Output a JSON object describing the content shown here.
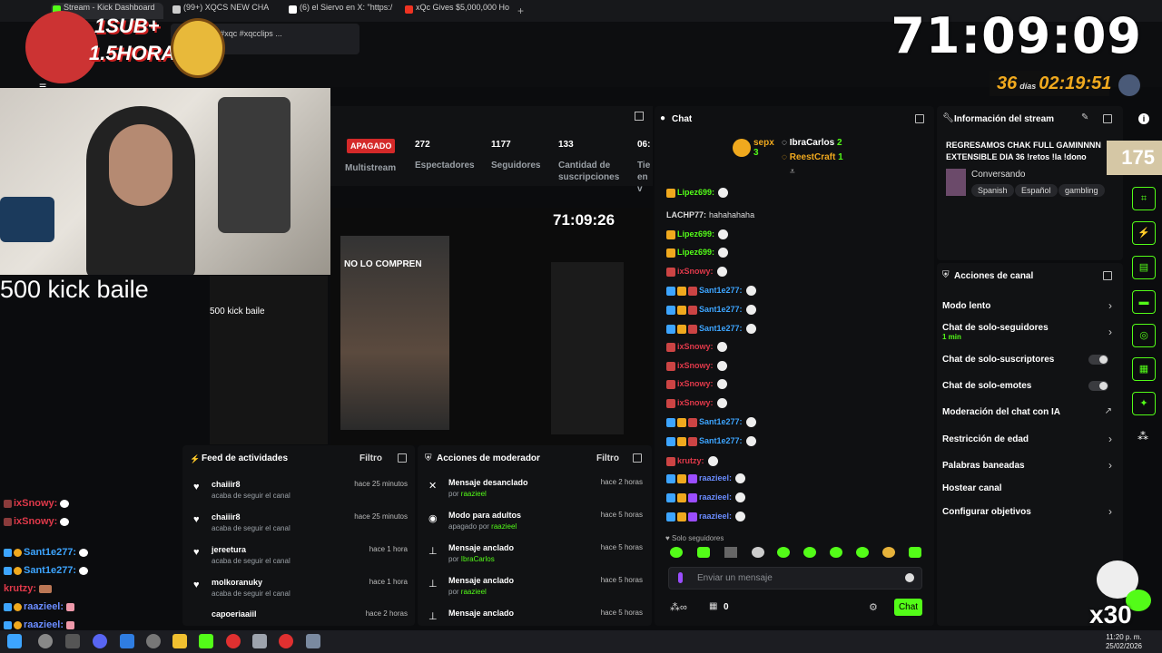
{
  "browser": {
    "tabs": [
      {
        "label": "Stream - Kick Dashboard",
        "color": "#53fc18"
      },
      {
        "label": "(99+) XQCS NEW CHA",
        "color": "#ccc"
      },
      {
        "label": "(6) el Siervo en X: \"https:/",
        "color": "#fff"
      },
      {
        "label": "xQc Gives $5,000,000 Ho",
        "color": "#e32"
      }
    ],
    "autocomplete": "CHAIN 🔴 #xqc #xqcclips ..."
  },
  "overlay": {
    "sub_badge_line1": "1SUB+",
    "sub_badge_line2": "1.5HORAS!",
    "timer": "71:09:09",
    "days_value": "36",
    "days_label": "días",
    "days_time": "02:19:51",
    "kick_baile": "500 kick baile",
    "counter": "175",
    "multiplier": "x30"
  },
  "dashboard": {
    "status": "APAGADO",
    "multistream": "Multistream",
    "stats": [
      {
        "value": "272",
        "label": "Espectadores"
      },
      {
        "value": "1177",
        "label": "Seguidores"
      },
      {
        "value": "133",
        "label": "Cantidad de suscripciones"
      },
      {
        "value": "06:",
        "label": "Tie en v"
      }
    ],
    "preview": {
      "clock": "71:09:26",
      "phone_title": "NO LO COMPREN",
      "kick_baile": "500 kick baile"
    }
  },
  "feed": {
    "title": "Feed de actividades",
    "filter": "Filtro",
    "items": [
      {
        "name": "chaiiir8",
        "sub": "acaba de seguir el canal",
        "time": "hace 25 minutos"
      },
      {
        "name": "chaiiir8",
        "sub": "acaba de seguir el canal",
        "time": "hace 25 minutos"
      },
      {
        "name": "jereetura",
        "sub": "acaba de seguir el canal",
        "time": "hace 1 hora"
      },
      {
        "name": "molkoranuky",
        "sub": "acaba de seguir el canal",
        "time": "hace 1 hora"
      },
      {
        "name": "capoeriaaiil",
        "sub": "",
        "time": "hace 2 horas"
      }
    ]
  },
  "mod": {
    "title": "Acciones de moderador",
    "filter": "Filtro",
    "items": [
      {
        "action": "Mensaje desanclado",
        "by": "por",
        "user": "raazieel",
        "time": "hace 2 horas",
        "icon": "unpin-icon"
      },
      {
        "action": "Modo para adultos",
        "by": "apagado por",
        "user": "raazieel",
        "time": "hace 5 horas",
        "icon": "eye-icon"
      },
      {
        "action": "Mensaje anclado",
        "by": "por",
        "user": "IbraCarlos",
        "time": "hace 5 horas",
        "icon": "pin-icon"
      },
      {
        "action": "Mensaje anclado",
        "by": "por",
        "user": "raazieel",
        "time": "hace 5 horas",
        "icon": "pin-icon"
      },
      {
        "action": "Mensaje anclado",
        "by": "",
        "user": "",
        "time": "hace 5 horas",
        "icon": "pin-icon"
      }
    ]
  },
  "chat": {
    "title": "Chat",
    "top": [
      {
        "name": "sepx",
        "count": "3"
      },
      {
        "name": "IbraCarlos",
        "count": "2"
      },
      {
        "name": "ReestCraft",
        "count": "1"
      }
    ],
    "messages": [
      {
        "user": "Lipez699:",
        "color": "#53fc18",
        "text": ""
      },
      {
        "user": "LACHP77:",
        "color": "#dddddd",
        "text": "hahahahaha"
      },
      {
        "user": "Lipez699:",
        "color": "#53fc18",
        "text": ""
      },
      {
        "user": "Lipez699:",
        "color": "#53fc18",
        "text": ""
      },
      {
        "user": "ixSnowy:",
        "color": "#e0394a",
        "text": ""
      },
      {
        "user": "Sant1e277:",
        "color": "#3da5ff",
        "text": ""
      },
      {
        "user": "Sant1e277:",
        "color": "#3da5ff",
        "text": ""
      },
      {
        "user": "Sant1e277:",
        "color": "#3da5ff",
        "text": ""
      },
      {
        "user": "ixSnowy:",
        "color": "#e0394a",
        "text": ""
      },
      {
        "user": "ixSnowy:",
        "color": "#e0394a",
        "text": ""
      },
      {
        "user": "ixSnowy:",
        "color": "#e0394a",
        "text": ""
      },
      {
        "user": "ixSnowy:",
        "color": "#e0394a",
        "text": ""
      },
      {
        "user": "Sant1e277:",
        "color": "#3da5ff",
        "text": ""
      },
      {
        "user": "Sant1e277:",
        "color": "#3da5ff",
        "text": ""
      },
      {
        "user": "krutzy:",
        "color": "#e0394a",
        "text": ""
      },
      {
        "user": "raazieel:",
        "color": "#6a8cff",
        "text": ""
      },
      {
        "user": "raazieel:",
        "color": "#6a8cff",
        "text": ""
      },
      {
        "user": "raazieel:",
        "color": "#6a8cff",
        "text": ""
      }
    ],
    "followers_only": "Solo seguidores",
    "placeholder": "Enviar un mensaje",
    "points": "0",
    "send": "Chat"
  },
  "info": {
    "title": "Información del stream",
    "stream_title": "REGRESAMOS CHAK FULL GAMINNNN EXTENSIBLE DIA 36 !retos !la !dono",
    "category": "Conversando",
    "tags": [
      "Spanish",
      "Español",
      "gambling"
    ]
  },
  "actions": {
    "title": "Acciones de canal",
    "items": [
      {
        "label": "Modo lento",
        "control": "chevron"
      },
      {
        "label": "Chat de solo-seguidores",
        "sub": "1 min",
        "control": "chevron"
      },
      {
        "label": "Chat de solo-suscriptores",
        "control": "toggle"
      },
      {
        "label": "Chat de solo-emotes",
        "control": "toggle"
      },
      {
        "label": "Moderación del chat con IA",
        "control": "link"
      },
      {
        "label": "Restricción de edad",
        "control": "chevron"
      },
      {
        "label": "Palabras baneadas",
        "control": "chevron"
      },
      {
        "label": "Hostear canal",
        "control": "none"
      },
      {
        "label": "Configurar objetivos",
        "control": "chevron"
      }
    ]
  },
  "left_chat": [
    {
      "user": "ixSnowy:",
      "color": "#e0394a"
    },
    {
      "user": "ixSnowy:",
      "color": "#e0394a"
    },
    {
      "user": "Sant1e277:",
      "color": "#3da5ff"
    },
    {
      "user": "Sant1e277:",
      "color": "#3da5ff"
    },
    {
      "user": "krutzy:",
      "color": "#e0394a"
    },
    {
      "user": "raazieel:",
      "color": "#6a8cff"
    },
    {
      "user": "raazieel:",
      "color": "#6a8cff"
    }
  ],
  "taskbar": {
    "time": "11:20 p. m.",
    "date": "25/02/2026"
  },
  "colors": {
    "kick_green": "#53fc18",
    "accent_orange": "#f0a91e"
  }
}
